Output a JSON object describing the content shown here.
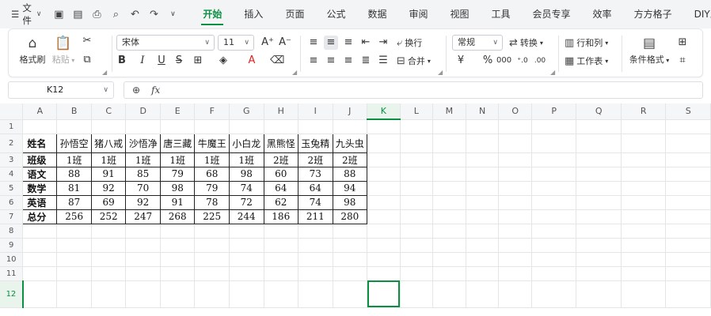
{
  "menu": {
    "file_label": "文件",
    "tabs": [
      "开始",
      "插入",
      "页面",
      "公式",
      "数据",
      "审阅",
      "视图",
      "工具",
      "会员专享",
      "效率",
      "方方格子",
      "DIY工具箱"
    ],
    "active_tab": "开始",
    "accent_color": "#0c8f43"
  },
  "ribbon": {
    "format_painter": "格式刷",
    "paste": "粘贴",
    "font_name": "宋体",
    "font_size": "11",
    "wrap_text": "换行",
    "merge": "合并",
    "number_format": "常规",
    "convert": "转换",
    "rows_cols": "行和列",
    "worksheet": "工作表",
    "conditional_format": "条件格式"
  },
  "formula_bar": {
    "cell_ref": "K12",
    "formula": ""
  },
  "sheet": {
    "columns": [
      "A",
      "B",
      "C",
      "D",
      "E",
      "F",
      "G",
      "H",
      "I",
      "J",
      "K",
      "L",
      "M",
      "N",
      "O",
      "P",
      "Q",
      "R",
      "S"
    ],
    "rows": [
      "1",
      "2",
      "3",
      "4",
      "5",
      "6",
      "7",
      "8",
      "9",
      "10",
      "11",
      "12"
    ],
    "selected_cell": "K12",
    "table": [
      [
        "姓名",
        "孙悟空",
        "猪八戒",
        "沙悟净",
        "唐三藏",
        "牛魔王",
        "小白龙",
        "黑熊怪",
        "玉兔精",
        "九头虫"
      ],
      [
        "班级",
        "1班",
        "1班",
        "1班",
        "1班",
        "1班",
        "1班",
        "2班",
        "2班",
        "2班"
      ],
      [
        "语文",
        "88",
        "91",
        "85",
        "79",
        "68",
        "98",
        "60",
        "73",
        "88"
      ],
      [
        "数学",
        "81",
        "92",
        "70",
        "98",
        "79",
        "74",
        "64",
        "64",
        "94"
      ],
      [
        "英语",
        "87",
        "69",
        "92",
        "91",
        "78",
        "72",
        "62",
        "74",
        "98"
      ],
      [
        "总分",
        "256",
        "252",
        "247",
        "268",
        "225",
        "244",
        "186",
        "211",
        "280"
      ]
    ]
  }
}
